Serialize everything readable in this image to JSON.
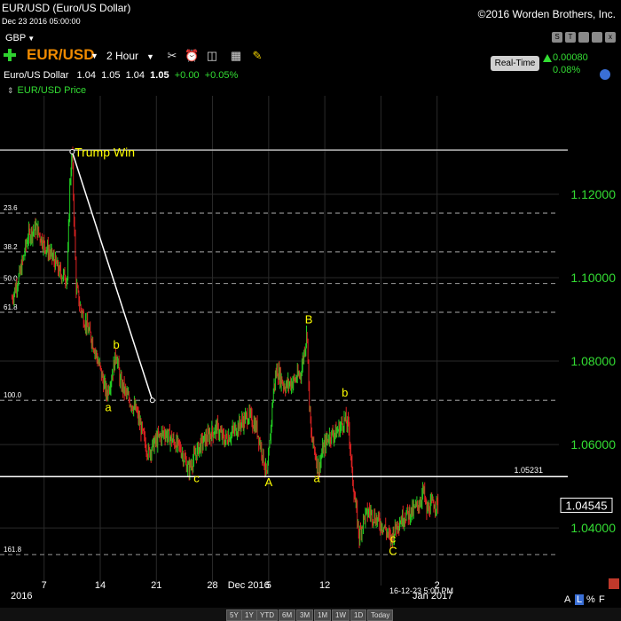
{
  "header": {
    "title": "EUR/USD (Euro/US Dollar)",
    "date": "Dec 23 2016 05:00:00",
    "copyright": "©2016 Worden Brothers, Inc.",
    "watchlist": "GBP"
  },
  "toolbar": {
    "symbol": "EUR/USD",
    "interval": "2 Hour",
    "realtime_label": "Real-Time",
    "change_abs": "0.00080",
    "change_pct": "0.08%",
    "icons": [
      "tools-icon",
      "alarm-icon",
      "calculator-icon",
      "note-icon"
    ],
    "right_buttons": [
      "S",
      "T",
      "",
      "",
      "x"
    ]
  },
  "quote": {
    "name": "Euro/US Dollar",
    "open": "1.04",
    "high": "1.05",
    "low": "1.04",
    "last": "1.05",
    "chg": "+0.00",
    "pct": "+0.05%"
  },
  "legend": {
    "label": "EUR/USD Price"
  },
  "bottom": {
    "range_buttons": [
      "5Y",
      "1Y",
      "YTD",
      "6M",
      "3M",
      "1M",
      "1W",
      "1D",
      "Today"
    ],
    "scale_a": "A",
    "scale_l": "L",
    "scale_pct": "%",
    "scale_f": "F"
  },
  "colors": {
    "price_axis": "#33dd33",
    "wave_label": "#ffff00",
    "up_bar": "#22cc22",
    "down_bar": "#dd2222",
    "fib_line": "#888888"
  },
  "chart_data": {
    "type": "line",
    "title": "EUR/USD Price",
    "y_ticks": [
      1.12,
      1.1,
      1.08,
      1.06,
      1.04
    ],
    "y_tick_labels": [
      "1.12000",
      "1.10000",
      "1.08000",
      "1.06000",
      "1.04000"
    ],
    "ylim": [
      1.0262,
      1.1436
    ],
    "x_ticks": [
      "7",
      "14",
      "21",
      "28",
      "Dec 2016",
      "5",
      "12",
      "2",
      "Jan 2017"
    ],
    "x_label_left": "2016",
    "x_cursor_label": "16-12-23 5:00 PM",
    "current_price": {
      "label": "1.04545",
      "value": 1.04545
    },
    "support_line": {
      "label": "1.05231",
      "value": 1.05231
    },
    "top_line": 1.1306,
    "fib_levels": [
      {
        "label": "23.6",
        "value": 1.1155
      },
      {
        "label": "38.2",
        "value": 1.1062
      },
      {
        "label": "50.0",
        "value": 1.0986
      },
      {
        "label": "61.8",
        "value": 1.0917
      },
      {
        "label": "100.0",
        "value": 1.0706
      },
      {
        "label": "161.8",
        "value": 1.0336
      }
    ],
    "trend_line": {
      "from": {
        "day": 10.5,
        "value": 1.1302
      },
      "to": {
        "day": 20.5,
        "value": 1.0706
      }
    },
    "wave_labels": [
      {
        "text": "Trump Win",
        "day": 10.8,
        "value": 1.129
      },
      {
        "text": "b",
        "day": 16.0,
        "value": 1.083
      },
      {
        "text": "a",
        "day": 15.0,
        "value": 1.068
      },
      {
        "text": "c",
        "day": 26.0,
        "value": 1.051
      },
      {
        "text": "A",
        "day": 35.0,
        "value": 1.05
      },
      {
        "text": "B",
        "day": 40.0,
        "value": 1.089
      },
      {
        "text": "a",
        "day": 41.0,
        "value": 1.051
      },
      {
        "text": "b",
        "day": 44.5,
        "value": 1.0715
      },
      {
        "text": "c",
        "day": 50.5,
        "value": 1.0365
      },
      {
        "text": "C",
        "day": 50.5,
        "value": 1.0335
      }
    ],
    "price_path": [
      [
        3.0,
        1.095
      ],
      [
        4.0,
        1.101
      ],
      [
        5.0,
        1.11
      ],
      [
        6.0,
        1.112
      ],
      [
        7.0,
        1.108
      ],
      [
        8.0,
        1.105
      ],
      [
        9.0,
        1.101
      ],
      [
        9.9,
        1.1
      ],
      [
        10.2,
        1.122
      ],
      [
        10.5,
        1.13
      ],
      [
        10.8,
        1.11
      ],
      [
        11.0,
        1.098
      ],
      [
        11.5,
        1.093
      ],
      [
        12.0,
        1.09
      ],
      [
        13.0,
        1.085
      ],
      [
        14.0,
        1.078
      ],
      [
        14.8,
        1.072
      ],
      [
        15.5,
        1.077
      ],
      [
        16.0,
        1.082
      ],
      [
        16.5,
        1.075
      ],
      [
        17.5,
        1.071
      ],
      [
        18.5,
        1.068
      ],
      [
        19.5,
        1.061
      ],
      [
        20.0,
        1.058
      ],
      [
        21.0,
        1.061
      ],
      [
        22.0,
        1.063
      ],
      [
        23.0,
        1.061
      ],
      [
        24.0,
        1.059
      ],
      [
        25.0,
        1.054
      ],
      [
        25.5,
        1.056
      ],
      [
        26.5,
        1.06
      ],
      [
        27.5,
        1.062
      ],
      [
        28.5,
        1.064
      ],
      [
        29.5,
        1.061
      ],
      [
        30.5,
        1.063
      ],
      [
        31.5,
        1.065
      ],
      [
        32.5,
        1.067
      ],
      [
        33.5,
        1.064
      ],
      [
        34.2,
        1.058
      ],
      [
        34.8,
        1.052
      ],
      [
        35.2,
        1.062
      ],
      [
        35.6,
        1.073
      ],
      [
        36.0,
        1.078
      ],
      [
        37.0,
        1.074
      ],
      [
        38.0,
        1.075
      ],
      [
        39.0,
        1.077
      ],
      [
        39.8,
        1.087
      ],
      [
        40.0,
        1.073
      ],
      [
        40.3,
        1.062
      ],
      [
        40.8,
        1.058
      ],
      [
        41.2,
        1.054
      ],
      [
        41.8,
        1.059
      ],
      [
        42.5,
        1.062
      ],
      [
        43.5,
        1.063
      ],
      [
        44.5,
        1.066
      ],
      [
        45.0,
        1.064
      ],
      [
        45.4,
        1.053
      ],
      [
        45.8,
        1.046
      ],
      [
        46.3,
        1.038
      ],
      [
        46.8,
        1.042
      ],
      [
        47.5,
        1.044
      ],
      [
        48.5,
        1.042
      ],
      [
        49.5,
        1.04
      ],
      [
        50.2,
        1.037
      ],
      [
        51.0,
        1.041
      ],
      [
        52.0,
        1.043
      ],
      [
        53.0,
        1.044
      ],
      [
        53.8,
        1.046
      ],
      [
        54.3,
        1.049
      ],
      [
        54.7,
        1.044
      ],
      [
        55.5,
        1.046
      ],
      [
        56.2,
        1.0455
      ]
    ]
  }
}
